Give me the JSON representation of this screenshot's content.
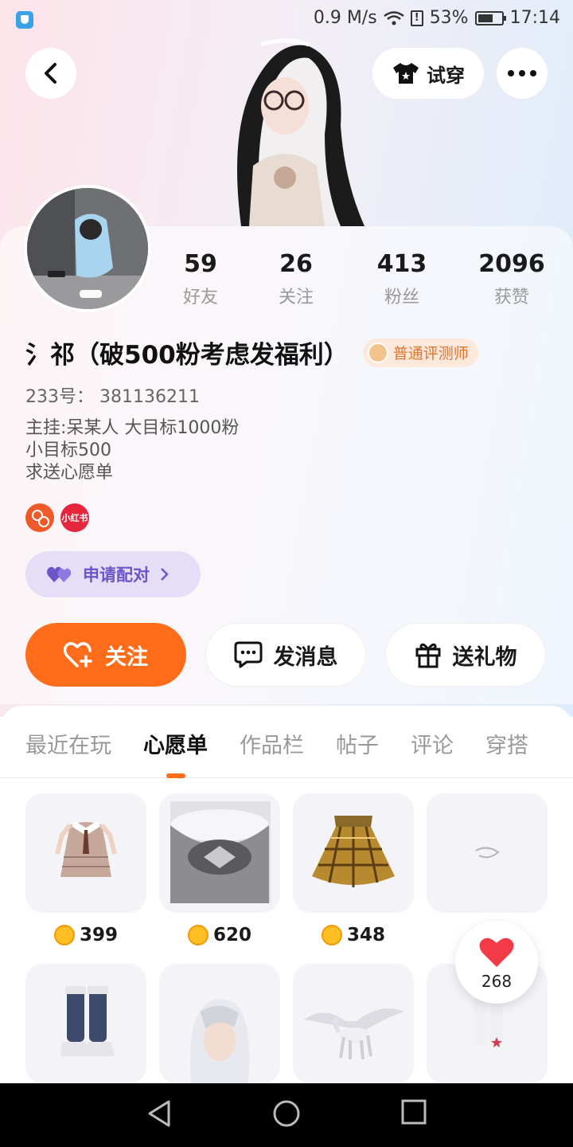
{
  "status_bar": {
    "speed": "0.9 M/s",
    "battery": "53%",
    "time": "17:14"
  },
  "hero": {
    "try_on_label": "试穿"
  },
  "profile": {
    "stats": [
      {
        "value": "59",
        "label": "好友"
      },
      {
        "value": "26",
        "label": "关注"
      },
      {
        "value": "413",
        "label": "粉丝"
      },
      {
        "value": "2096",
        "label": "获赞"
      }
    ],
    "name": "氵祁（破500粉考虑发福利）",
    "badge": "普通评测师",
    "uid": "233号： 381136211",
    "bio": [
      "主挂:呆某人 大目标1000粉",
      "小目标500",
      "求送心愿单"
    ],
    "social": {
      "xiaohongshu": "小红书"
    },
    "pair_label": "申请配对"
  },
  "actions": {
    "follow": "关注",
    "message": "发消息",
    "gift": "送礼物"
  },
  "tabs": [
    "最近在玩",
    "心愿单",
    "作品栏",
    "帖子",
    "评论",
    "穿搭"
  ],
  "active_tab": "心愿单",
  "wishlist": [
    {
      "icon": "outfit-dress-icon",
      "price": "399"
    },
    {
      "icon": "crystal-crown-icon",
      "price": "620"
    },
    {
      "icon": "plaid-skirt-icon",
      "price": "348"
    },
    {
      "icon": "hair-clip-icon",
      "price": ""
    },
    {
      "icon": "boots-icon",
      "price": ""
    },
    {
      "icon": "white-hair-icon",
      "price": ""
    },
    {
      "icon": "pegasus-icon",
      "price": ""
    },
    {
      "icon": "star-shoes-icon",
      "price": ""
    }
  ],
  "like_count": "268",
  "colors": {
    "accent": "#ff6d1a",
    "pair": "#6a56c8",
    "badge": "#e0742c"
  }
}
